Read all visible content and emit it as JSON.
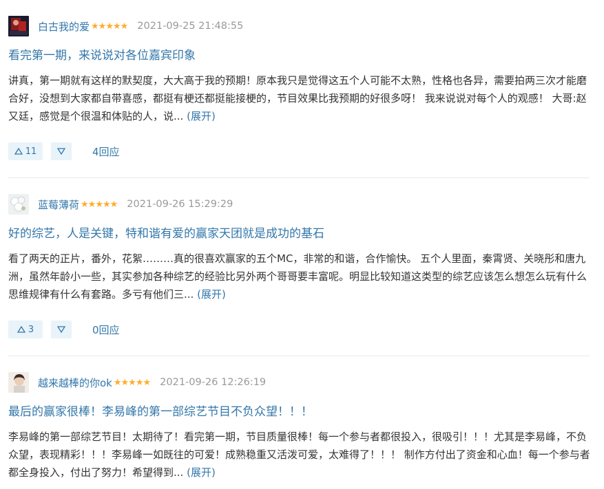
{
  "colors": {
    "link": "#3377aa",
    "star": "#ffac2d",
    "vote_bg": "#e9f3fa",
    "meta": "#999999",
    "text": "#333333"
  },
  "reviews": [
    {
      "username": "白古我的爱",
      "stars": "★★★★★",
      "time": "2021-09-25 21:48:55",
      "title": "看完第一期，来说说对各位嘉宾印象",
      "body": "讲真，第一期就有这样的默契度，大大高于我的预期！原本我只是觉得这五个人可能不太熟，性格也各异，需要拍两三次才能磨合好，没想到大家都自带喜感，都挺有梗还都挺能接梗的，节目效果比我预期的好很多呀！ 我来说说对每个人的观感！ 大哥:赵又廷，感觉是个很温和体贴的人，说...",
      "expand": "(展开)",
      "upvotes": "11",
      "replies": "4回应"
    },
    {
      "username": "蓝莓薄荷",
      "stars": "★★★★★",
      "time": "2021-09-26 15:29:29",
      "title": "好的综艺，人是关键，特和谐有爱的赢家天团就是成功的基石",
      "body": "看了两天的正片，番外，花絮………真的很喜欢赢家的五个MC，非常的和谐，合作愉快。 五个人里面，秦霄贤、关晓彤和唐九洲，虽然年龄小一些，其实参加各种综艺的经验比另外两个哥哥要丰富呢。明显比较知道这类型的综艺应该怎么想怎么玩有什么思维规律有什么有套路。多亏有他们三...",
      "expand": "(展开)",
      "upvotes": "3",
      "replies": "0回应"
    },
    {
      "username": "越来越棒的你ok",
      "stars": "★★★★★",
      "time": "2021-09-26 12:26:19",
      "title": "最后的赢家很棒！李易峰的第一部综艺节目不负众望！！！",
      "body": "李易峰的第一部综艺节目！太期待了！看完第一期，节目质量很棒！每一个参与者都很投入，很吸引！！！尤其是李易峰，不负众望，表现精彩！！！李易峰一如既往的可爱！成熟稳重又活泼可爱，太难得了！！！ 制作方付出了资金和心血！每一个参与者都全身投入，付出了努力！希望得到...",
      "expand": "(展开)"
    }
  ]
}
